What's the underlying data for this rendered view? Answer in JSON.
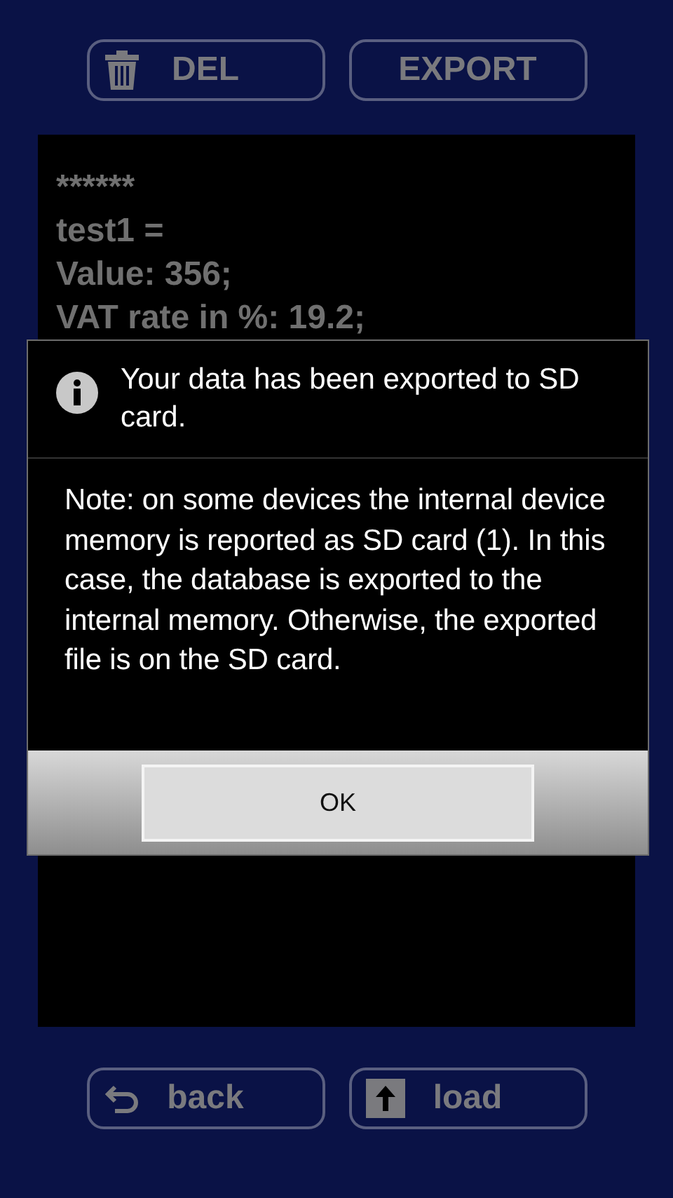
{
  "top_buttons": [
    {
      "kind": "delete",
      "label": "DEL"
    },
    {
      "kind": "plain",
      "label": "EXPORT"
    }
  ],
  "records": [
    "******",
    "test1 =",
    "Value: 356;",
    "VAT rate in %: 19.2;"
  ],
  "dialog": {
    "title": "Your data has been exported to SD card.",
    "message": "Note: on some devices the internal device memory is reported as SD card (1). In this case, the database is exported to the internal memory. Otherwise, the exported file is on the SD card.",
    "button": "OK"
  },
  "bottom_buttons": [
    {
      "kind": "back",
      "label": "back"
    },
    {
      "kind": "upload",
      "label": "load"
    }
  ]
}
